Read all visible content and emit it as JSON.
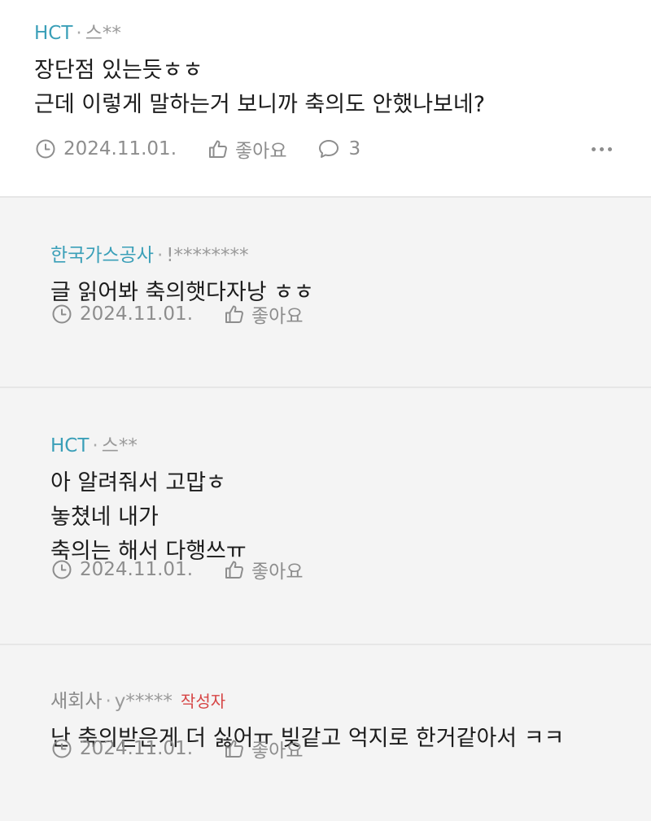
{
  "comments": [
    {
      "author": "HCT",
      "user_masked": "스**",
      "lines": [
        "장단점 있는듯ㅎㅎ",
        "근데 이렇게 말하는거 보니까 축의도 안했나보네?"
      ],
      "date": "2024.11.01.",
      "like_label": "좋아요",
      "reply_count": "3"
    },
    {
      "author": "한국가스공사",
      "user_masked": "!********",
      "lines": [
        "글 읽어봐 축의햇다자낭 ㅎㅎ"
      ],
      "date": "2024.11.01.",
      "like_label": "좋아요"
    },
    {
      "author": "HCT",
      "user_masked": "스**",
      "lines": [
        "아 알려줘서 고맙ㅎ",
        "놓쳤네 내가",
        "축의는 해서 다행쓰ㅠ"
      ],
      "date": "2024.11.01.",
      "like_label": "좋아요"
    },
    {
      "author": "새회사",
      "user_masked": "y*****",
      "writer_tag": "작성자",
      "lines": [
        "난 축의받은게 더 싫어ㅠ 빚같고 억지로 한거같아서 ㅋㅋ"
      ],
      "date": "2024.11.01.",
      "like_label": "좋아요"
    }
  ],
  "separator": "·",
  "icons": {
    "date": "clock-icon",
    "like": "thumbs-up-icon",
    "reply": "speech-bubble-icon",
    "more": "more-dots-icon"
  },
  "colors": {
    "author_link": "#3a9fb8",
    "writer_tag": "#d64545",
    "meta_gray": "#8d8d8d",
    "reply_background": "#f4f4f4"
  }
}
